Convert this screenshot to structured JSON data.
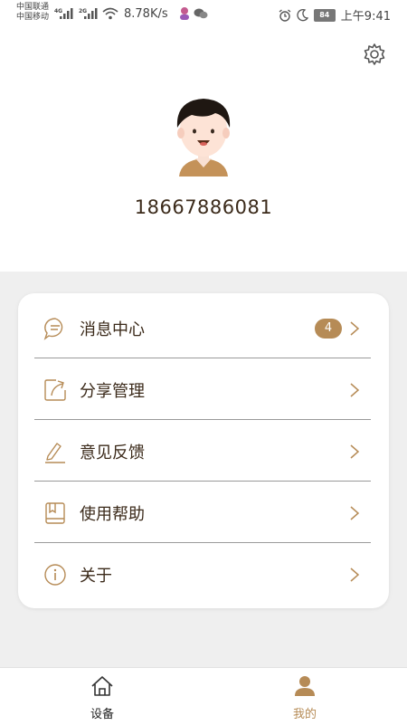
{
  "status_bar": {
    "carrier_1": "中国联通",
    "carrier_2": "中国移动",
    "net_1": "4G",
    "net_2": "2G",
    "speed": "8.78K/s",
    "battery": "84",
    "time": "上午9:41"
  },
  "profile": {
    "phone": "18667886081"
  },
  "menu": {
    "items": [
      {
        "label": "消息中心",
        "icon": "message-icon",
        "badge": "4"
      },
      {
        "label": "分享管理",
        "icon": "share-icon"
      },
      {
        "label": "意见反馈",
        "icon": "feedback-edit-icon"
      },
      {
        "label": "使用帮助",
        "icon": "help-book-icon"
      },
      {
        "label": "关于",
        "icon": "info-icon"
      }
    ]
  },
  "bottom_nav": {
    "items": [
      {
        "label": "设备",
        "icon": "home-icon",
        "active": false
      },
      {
        "label": "我的",
        "icon": "user-icon",
        "active": true
      }
    ]
  },
  "colors": {
    "accent": "#b68b56",
    "text": "#3b2a1a",
    "inactive_nav": "#222222"
  }
}
